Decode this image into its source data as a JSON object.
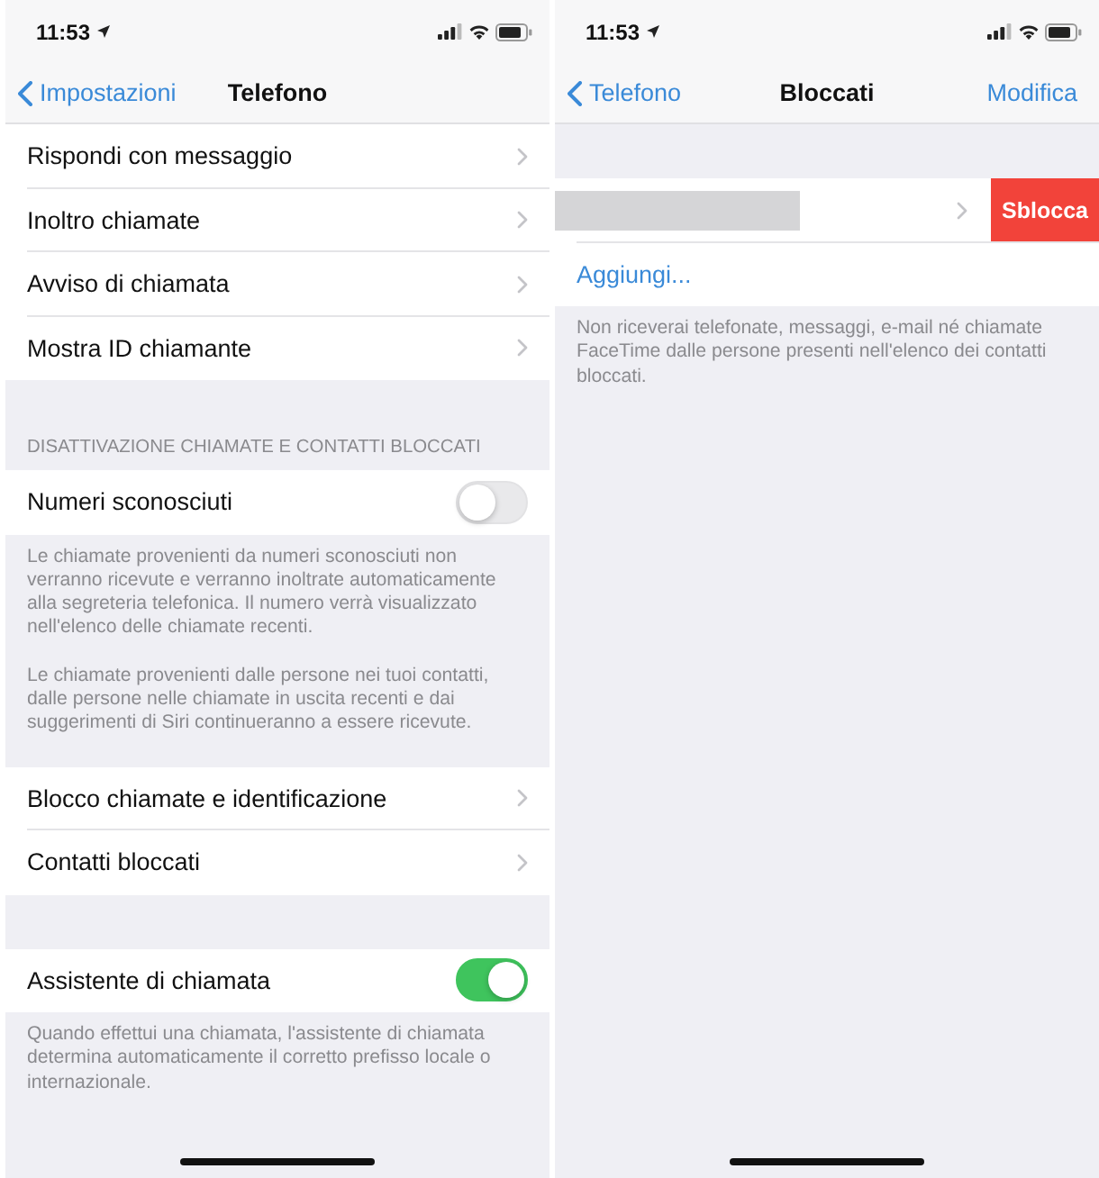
{
  "screens": [
    {
      "status_bar": {
        "time": "11:53"
      },
      "nav_bar": {
        "back": "Impostazioni",
        "title": "Telefono"
      },
      "sections": [
        {
          "rows": [
            {
              "kind": "link",
              "label": "Rispondi con messaggio"
            },
            {
              "kind": "link",
              "label": "Inoltro chiamate"
            },
            {
              "kind": "link",
              "label": "Avviso di chiamata"
            },
            {
              "kind": "link",
              "label": "Mostra ID chiamante"
            }
          ]
        },
        {
          "header": "DISATTIVAZIONE CHIAMATE E CONTATTI BLOCCATI",
          "rows": [
            {
              "kind": "toggle",
              "label": "Numeri sconosciuti",
              "on": false
            }
          ],
          "footer": [
            "Le chiamate provenienti da numeri sconosciuti non verranno ricevute e verranno inoltrate automaticamente alla segreteria telefonica. Il numero verrà visualizzato nell'elenco delle chiamate recenti.",
            "Le chiamate provenienti dalle persone nei tuoi contatti, dalle persone nelle chiamate in uscita recenti e dai suggerimenti di Siri continueranno a essere ricevute."
          ]
        },
        {
          "rows": [
            {
              "kind": "link",
              "label": "Blocco chiamate e identificazione"
            },
            {
              "kind": "link",
              "label": "Contatti bloccati"
            }
          ]
        },
        {
          "rows": [
            {
              "kind": "toggle",
              "label": "Assistente di chiamata",
              "on": true
            }
          ],
          "footer": [
            "Quando effettui una chiamata, l'assistente di chiamata determina automaticamente il corretto prefisso locale o internazionale."
          ]
        }
      ]
    },
    {
      "status_bar": {
        "time": "11:53"
      },
      "nav_bar": {
        "back": "Telefono",
        "title": "Bloccati",
        "action": "Modifica"
      },
      "sections": [
        {
          "rows": [
            {
              "kind": "swiped",
              "action": "Sblocca"
            },
            {
              "kind": "action",
              "label": "Aggiungi..."
            }
          ],
          "footer": [
            "Non riceverai telefonate, messaggi, e-mail né chiamate FaceTime dalle persone presenti nell'elenco dei contatti bloccati."
          ]
        }
      ]
    }
  ]
}
